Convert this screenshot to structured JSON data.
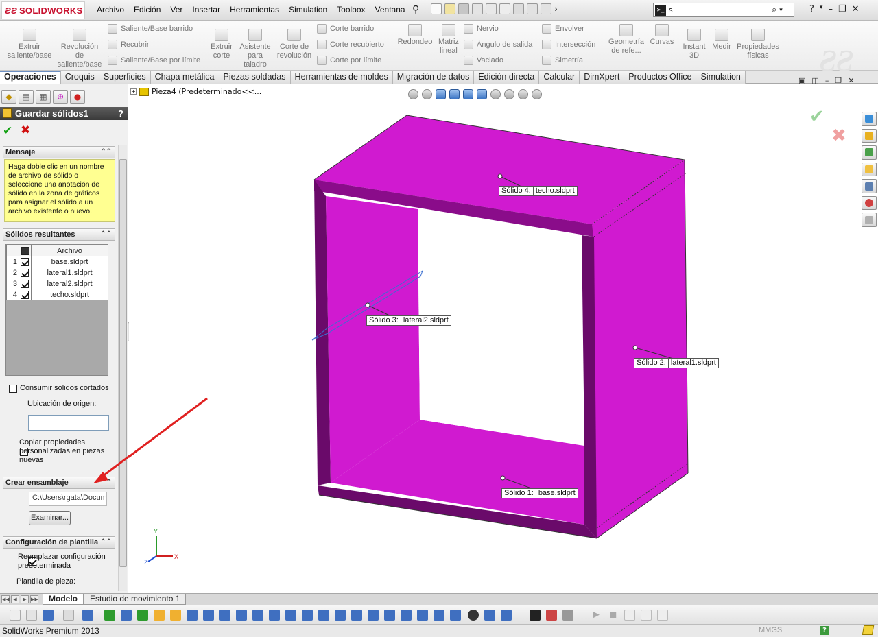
{
  "app": {
    "brand": "SOLIDWORKS",
    "menu": [
      "Archivo",
      "Edición",
      "Ver",
      "Insertar",
      "Herramientas",
      "Simulation",
      "Toolbox",
      "Ventana"
    ],
    "search": {
      "value": "s"
    }
  },
  "commands": {
    "extrude": "Extruir saliente/base",
    "revolve": "Revolución de saliente/base",
    "sweep": "Saliente/Base barrido",
    "loft": "Recubrir",
    "boundary": "Saliente/Base por límite",
    "extruded_cut": "Extruir corte",
    "hole_wizard": "Asistente para taladro",
    "revolved_cut": "Corte de revolución",
    "swept_cut": "Corte barrido",
    "lofted_cut": "Corte recubierto",
    "boundary_cut": "Corte por límite",
    "fillet": "Redondeo",
    "pattern": "Matriz lineal",
    "rib": "Nervio",
    "draft": "Ángulo de salida",
    "shell": "Vaciado",
    "wrap": "Envolver",
    "intersect": "Intersección",
    "mirror": "Simetría",
    "ref_geometry": "Geometría de refe...",
    "curves": "Curvas",
    "instant3d": "Instant 3D",
    "measure": "Medir",
    "mass_props": "Propiedades físicas"
  },
  "tabs": [
    "Operaciones",
    "Croquis",
    "Superficies",
    "Chapa metálica",
    "Piezas soldadas",
    "Herramientas de moldes",
    "Migración de datos",
    "Edición directa",
    "Calcular",
    "DimXpert",
    "Productos Office",
    "Simulation"
  ],
  "tree": {
    "part": "Pieza4  (Predeterminado<<..."
  },
  "panel": {
    "title": "Guardar sólidos1",
    "help": "?",
    "message_header": "Mensaje",
    "message": "Haga doble clic en un nombre de archivo de sólido o seleccione una anotación de sólido en la zona de gráficos para asignar el sólido a un archivo existente o nuevo.",
    "solids_header": "Sólidos resultantes",
    "column_file": "Archivo",
    "solids": [
      {
        "num": "1",
        "file": "base.sldprt"
      },
      {
        "num": "2",
        "file": "lateral1.sldprt"
      },
      {
        "num": "3",
        "file": "lateral2.sldprt"
      },
      {
        "num": "4",
        "file": "techo.sldprt"
      }
    ],
    "consume_label": "Consumir sólidos cortados",
    "origin_label": "Ubicación de origen:",
    "origin_value": "",
    "copy_props_label": "Copiar propiedades personalizadas en piezas nuevas",
    "assembly_header": "Crear ensamblaje",
    "assembly_path": "C:\\Users\\rgata\\Docum",
    "browse_label": "Examinar...",
    "template_header": "Configuración de plantilla",
    "replace_label": "Reemplazar configuración predeterminada",
    "part_template_label": "Plantilla de pieza:"
  },
  "callouts": [
    {
      "name": "Sólido 4:",
      "file": "techo.sldprt"
    },
    {
      "name": "Sólido 3:",
      "file": "lateral2.sldprt"
    },
    {
      "name": "Sólido 2:",
      "file": "lateral1.sldprt"
    },
    {
      "name": "Sólido 1:",
      "file": "base.sldprt"
    }
  ],
  "bottom_tabs": [
    "Modelo",
    "Estudio de movimiento 1"
  ],
  "status": {
    "text": "SolidWorks Premium 2013",
    "units": "MMGS"
  },
  "colors": {
    "part": "#cc14cc",
    "part_dark": "#6a0a6a",
    "annotation_arrow": "#e02020"
  }
}
